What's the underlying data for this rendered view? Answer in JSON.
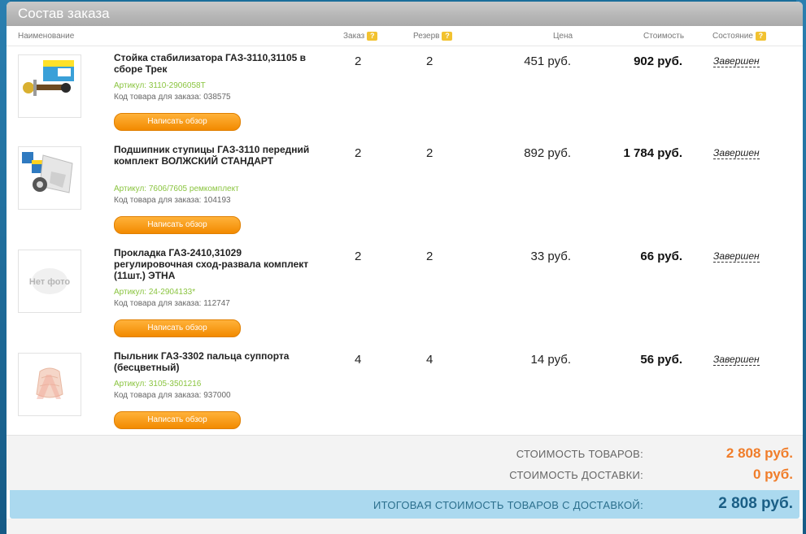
{
  "panel": {
    "title": "Состав заказа"
  },
  "columns": {
    "name": "Наименование",
    "order": "Заказ",
    "reserve": "Резерв",
    "price": "Цена",
    "cost": "Стоимость",
    "status": "Состояние",
    "help": "?"
  },
  "items": [
    {
      "name": "Стойка стабилизатора ГАЗ-3110,31105 в сборе Трек",
      "sku": "Артикул: 3110-2906058Т",
      "code": "Код товара для заказа: 038575",
      "order": "2",
      "reserve": "2",
      "price": "451 руб.",
      "total": "902 руб.",
      "status": "Завершен",
      "review": "Написать обзор"
    },
    {
      "name": "Подшипник ступицы ГАЗ-3110 передний комплект ВОЛЖСКИЙ СТАНДАРТ",
      "sku": "Артикул: 7606/7605 ремкомплект",
      "code": "Код товара для заказа: 104193",
      "order": "2",
      "reserve": "2",
      "price": "892 руб.",
      "total": "1 784 руб.",
      "status": "Завершен",
      "review": "Написать обзор"
    },
    {
      "name": "Прокладка ГАЗ-2410,31029 регулировочная сход-развала комплект (11шт.) ЭТНА",
      "sku": "Артикул: 24-2904133*",
      "code": "Код товара для заказа: 112747",
      "order": "2",
      "reserve": "2",
      "price": "33 руб.",
      "total": "66 руб.",
      "status": "Завершен",
      "review": "Написать обзор",
      "no_photo": "Нет фото"
    },
    {
      "name": "Пыльник ГАЗ-3302 пальца суппорта (бесцветный)",
      "sku": "Артикул: 3105-3501216",
      "code": "Код товара для заказа: 937000",
      "order": "4",
      "reserve": "4",
      "price": "14 руб.",
      "total": "56 руб.",
      "status": "Завершен",
      "review": "Написать обзор"
    }
  ],
  "summary": {
    "goods_label": "СТОИМОСТЬ ТОВАРОВ:",
    "goods_value": "2 808 руб.",
    "delivery_label": "СТОИМОСТЬ ДОСТАВКИ:",
    "delivery_value": "0 руб.",
    "grand_label": "ИТОГОВАЯ СТОИМОСТЬ ТОВАРОВ С ДОСТАВКОЙ:",
    "grand_value": "2 808 руб."
  },
  "colors": {
    "accent_orange": "#f28a00",
    "sku_green": "#8ac43f",
    "total_blue": "#1b5f86",
    "summary_orange": "#f07d2a"
  }
}
